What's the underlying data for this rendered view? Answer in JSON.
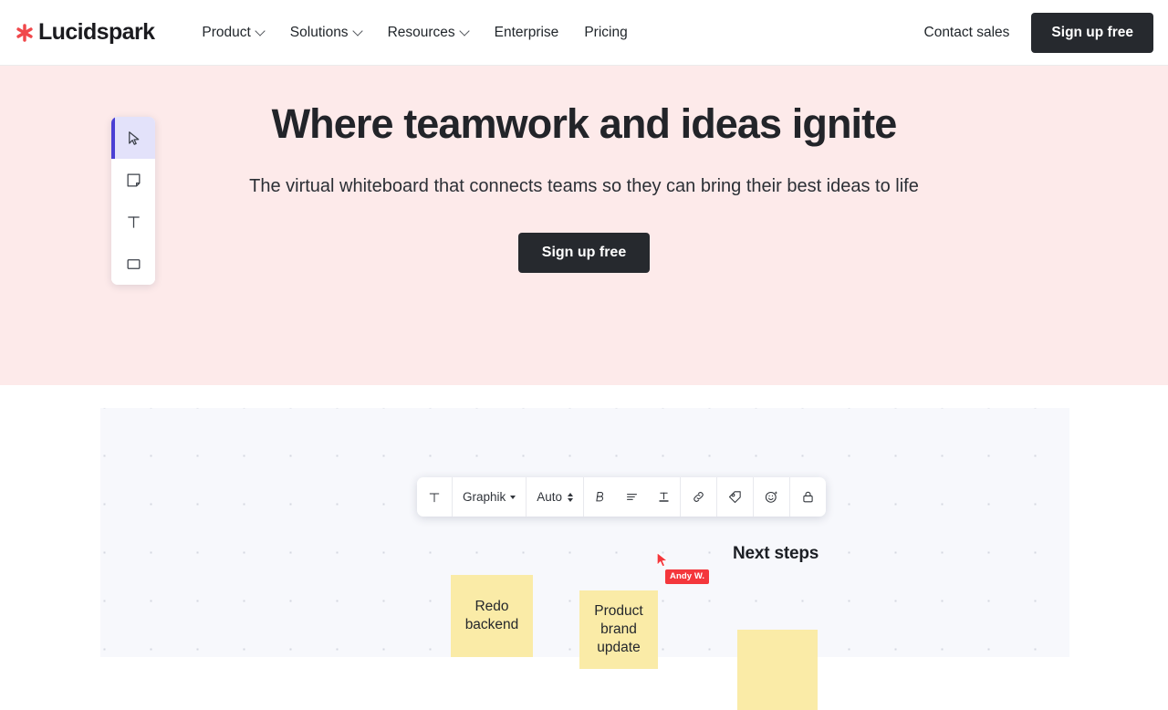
{
  "brand": {
    "name": "Lucidspark",
    "mark": "asterisk-logo",
    "accent": "#F0484B"
  },
  "nav": {
    "links": [
      {
        "label": "Product",
        "has_menu": true
      },
      {
        "label": "Solutions",
        "has_menu": true
      },
      {
        "label": "Resources",
        "has_menu": true
      },
      {
        "label": "Enterprise",
        "has_menu": false
      },
      {
        "label": "Pricing",
        "has_menu": false
      }
    ],
    "contact_sales": "Contact sales",
    "signup": "Sign up free"
  },
  "hero": {
    "title": "Where teamwork and ideas ignite",
    "subtitle": "The virtual whiteboard that connects teams so they can bring their best ideas to life",
    "cta": "Sign up free",
    "background": "#FDEAEA"
  },
  "board": {
    "background": "#F7F8FC",
    "tools": [
      {
        "name": "select-tool",
        "icon": "cursor-icon",
        "active": true
      },
      {
        "name": "sticky-note-tool",
        "icon": "sticky-note-icon",
        "active": false
      },
      {
        "name": "text-tool",
        "icon": "text-t-icon",
        "active": false,
        "label": "T"
      },
      {
        "name": "shape-tool",
        "icon": "rectangle-icon",
        "active": false
      }
    ],
    "toolbar": {
      "text_style_icon": "text-format-icon",
      "font_family": "Graphik",
      "font_size": "Auto",
      "bold_icon": "bold-icon",
      "align_icon": "align-icon",
      "text_color_icon": "text-color-icon",
      "link_icon": "link-icon",
      "tag_icon": "tag-icon",
      "emoji_icon": "emoji-sparkle-icon",
      "lock_icon": "lock-icon"
    },
    "heading": "Next steps",
    "notes": [
      {
        "text": "Redo backend",
        "color": "#FAEBA7"
      },
      {
        "text": "Product brand update",
        "color": "#FAEBA7"
      },
      {
        "text": "",
        "color": "#FAEBA7"
      }
    ],
    "cursor": {
      "user": "Andy W.",
      "color": "#F4373C"
    }
  }
}
